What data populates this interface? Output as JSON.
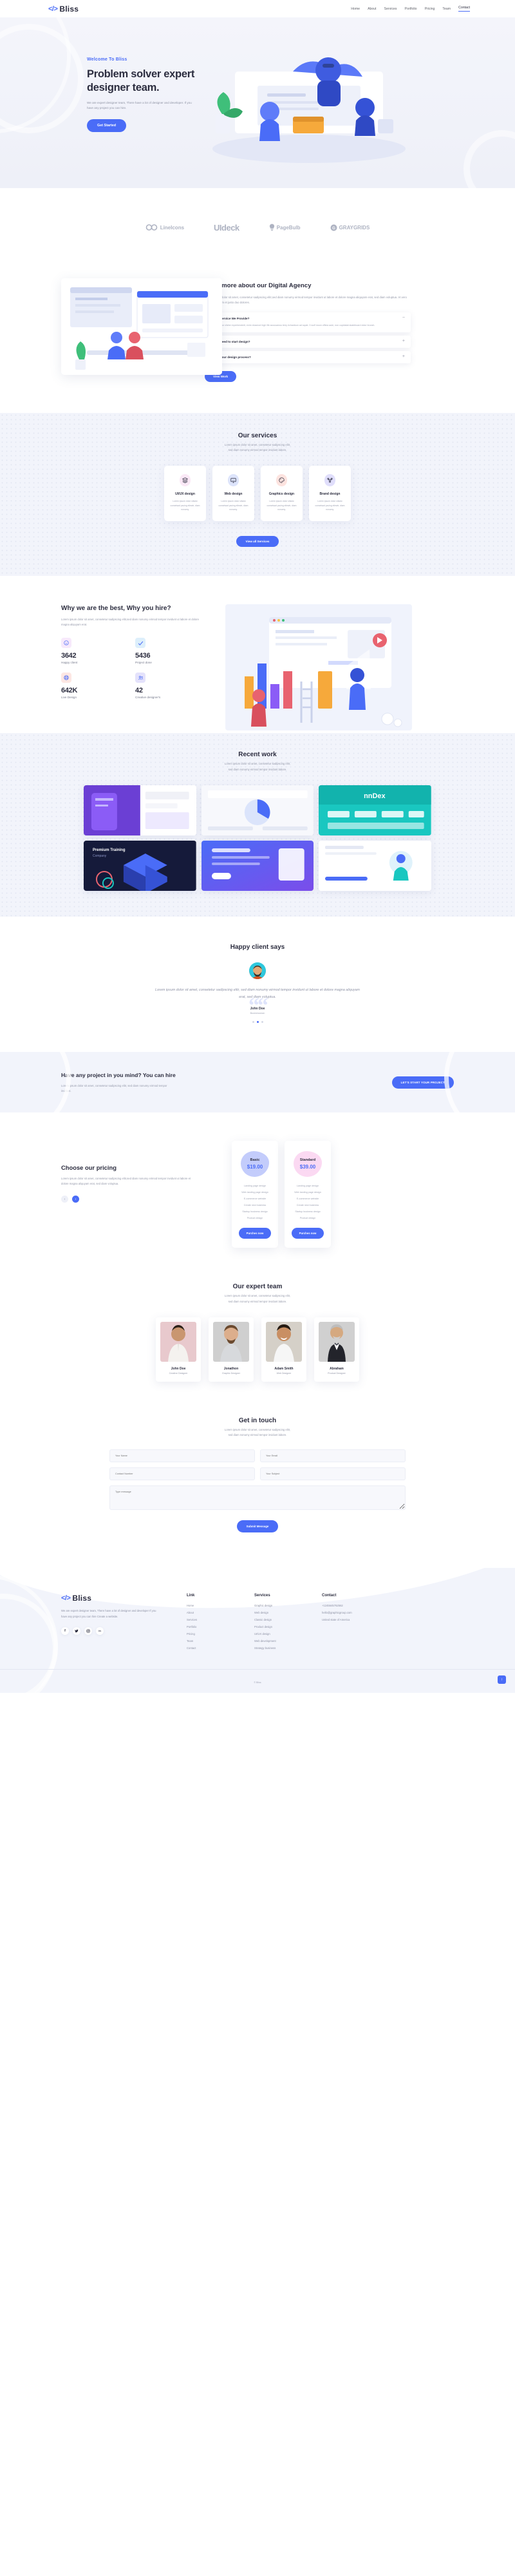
{
  "brand": {
    "mark": "</>",
    "name": "Bliss"
  },
  "colors": {
    "accent": "#4a6cf7",
    "dark": "#2c2d3f",
    "muted": "#9599aa",
    "light_bg": "#f2f4fb"
  },
  "nav": {
    "items": [
      "Home",
      "About",
      "Services",
      "Portfolio",
      "Pricing",
      "Team",
      "Contact"
    ],
    "active": "Contact"
  },
  "hero": {
    "kicker": "Welcome To Bliss",
    "title": "Problem solver expert designer team.",
    "desc": "We are expert designer team, There have a lot of designer and developer. If you have any project you can hire.",
    "button": "Get Started"
  },
  "brands": [
    {
      "name": "LineIcons",
      "icon": "infinity-icon"
    },
    {
      "name": "UIdeck",
      "icon": "uideck-icon"
    },
    {
      "name": "PageBulb",
      "icon": "bulb-icon"
    },
    {
      "name": "GRAYGRIDS",
      "icon": "circle-g-icon"
    }
  ],
  "about": {
    "title": "Read more about our Digital Agency",
    "desc": "Lorem ipsum dolor sit amet, consetetur sadipscing elitr,sed diam nonumy eirmod tempor invidunt ut labore et dolore magna aliquyam erat, sed diam voluptua. At vero eos et accusam et justo duo dolores.",
    "faq": [
      {
        "q": "Which Service We Provide?",
        "sign": "−",
        "a": "Anim pariatur cliche reprehenderit, enim eiusmod high life accusamus terry richardson ad squid. 3 wolf moon officia aute, non cupidatat skateboard dolor brunch.",
        "open": true
      },
      {
        "q": "What I need to start design?",
        "sign": "+",
        "a": "",
        "open": false
      },
      {
        "q": "What is our design process?",
        "sign": "+",
        "a": "",
        "open": false
      }
    ],
    "button": "View Work"
  },
  "services": {
    "title": "Our services",
    "subtitle": "Lorem ipsum dolor sit amet, consetetur sadipscing elitr,\nsed diam nonumy eirmod tempor invidunt labore.",
    "cards": [
      {
        "name": "UI/UX design",
        "text": "Lorem ipsum dolor sitsdw consetsad pscing eliewtr, diam nonumy.",
        "icon": "layers-icon",
        "bg": "#fbe8f6"
      },
      {
        "name": "Web design",
        "text": "Lorem ipsum dolor sitsdw consetsad pscing eliewtr, diam nonumy.",
        "icon": "code-monitor-icon",
        "bg": "#dde4fb"
      },
      {
        "name": "Graphics design",
        "text": "Lorem ipsum dolor sitsdw consetsad pscing eliewtr, diam nonumy.",
        "icon": "palette-icon",
        "bg": "#fde3df"
      },
      {
        "name": "Brand design",
        "text": "Lorem ipsum dolor sitsdw consetsad pscing eliewtr, diam nonumy.",
        "icon": "network-icon",
        "bg": "#e0defb"
      }
    ],
    "button": "View all Services"
  },
  "why": {
    "title": "Why we are the best, Why you hire?",
    "desc": "Lorem ipsum dolor sit amet, consetetur sadipscing elitr,sed diam nonumy eirmod tempor invidunt ut labore et dolore magna aliquyam erat.",
    "stats": [
      {
        "value": "3642",
        "label": "Happy client",
        "icon": "smiley-icon",
        "bg": "#f7e9fb"
      },
      {
        "value": "5436",
        "label": "Project done",
        "icon": "check-icon",
        "bg": "#ddeffb"
      },
      {
        "value": "642K",
        "label": "Live Design",
        "icon": "globe-icon",
        "bg": "#fde7e3"
      },
      {
        "value": "42",
        "label": "Creative designer's",
        "icon": "users-icon",
        "bg": "#e4e2fb"
      }
    ]
  },
  "portfolio": {
    "title": "Recent work",
    "subtitle": "Lorem ipsum dolor sit amet, consetetur sadipscing elitr,\nsed diam nonumy eirmod tempor invidunt labore.",
    "items": [
      {
        "name": "mobile-app-purple"
      },
      {
        "name": "dashboard-light"
      },
      {
        "name": "branding-teal"
      },
      {
        "name": "isometric-dark"
      },
      {
        "name": "blue-gradient-ui"
      },
      {
        "name": "illustration-white"
      }
    ]
  },
  "testimonial": {
    "title": "Happy client says",
    "quote": "Lorem ipsum dolor sit amet, consetetur sadipscing elitr, sed diam nonumy eirmod tempor invidunt ut labore et dolore magna aliquyam erat, sed diam voluptua.",
    "name": "John Doe",
    "role": "Businessman",
    "dots": 3,
    "active_dot": 1
  },
  "cta": {
    "title": "Have any project in you mind? You can hire",
    "desc": "Lorem ipsum dolor sit amet, consetetur sadipscing elitr, sed diam nonumy eirmod tempor invidunt.",
    "button": "LET'S START YOUR PROJECT"
  },
  "pricing": {
    "title": "Choose our pricing",
    "desc": "Lorem ipsum dolor sit amet, consetetur sadipscing elitr,sed diam nonumy eirmod tempor invidunt ut labore et dolore magna aliquyam erat, sed diam voluptua.",
    "prev": "‹",
    "next": "›",
    "plans": [
      {
        "name": "Basic",
        "price": "$19.00",
        "blob": "#c3ccfb",
        "features": [
          "Landing page design",
          "Web landing page design",
          "E-commerce website",
          "Create new business",
          "Startup business design",
          "Product design"
        ],
        "button": "Purches now"
      },
      {
        "name": "Standard",
        "price": "$39.00",
        "blob": "#fbd9f2",
        "features": [
          "Landing page design",
          "Web landing page design",
          "E-commerce website",
          "Create new business",
          "Startup business design",
          "Product design"
        ],
        "button": "Purches now"
      }
    ]
  },
  "team": {
    "title": "Our expert team",
    "subtitle": "Lorem ipsum dolor sit amet, consetetur sadipscing elitr,\nsed diam nonumy eirmod tempor invidunt labore.",
    "members": [
      {
        "name": "John Doe",
        "role": "Creative Designer",
        "bg": "#e8c9cd",
        "shirt": "#f4f2ef",
        "skin": "#c99670"
      },
      {
        "name": "Jonathon",
        "role": "Graphic Designer",
        "bg": "#cfcfcf",
        "shirt": "#d7d9dc",
        "skin": "#dcae8c"
      },
      {
        "name": "Adam Smith",
        "role": "Web Designer",
        "bg": "#d5d0c8",
        "shirt": "#f6f6f6",
        "skin": "#c98f63"
      },
      {
        "name": "Abraham",
        "role": "Product Designer",
        "bg": "#d0d0d0",
        "shirt": "#23242b",
        "skin": "#d5a980"
      }
    ]
  },
  "contact": {
    "title": "Get in touch",
    "subtitle": "Lorem ipsum dolor sit amet, consetetur sadipscing elitr,\nsed diam nonumy eirmod tempor invidunt labore.",
    "fields": {
      "name_placeholder": "Your Name",
      "email_placeholder": "Your Email",
      "phone_placeholder": "Contact Number",
      "subject_placeholder": "Your Subject",
      "message_placeholder": "Type message"
    },
    "button": "Submit Message"
  },
  "footer": {
    "desc": "We are expert designer team, There have a lot of designer and developer If you have any project you can hire Create a website.",
    "social": [
      {
        "name": "facebook-icon",
        "glyph": "f"
      },
      {
        "name": "twitter-icon",
        "glyph": "ᴛ"
      },
      {
        "name": "instagram-icon",
        "glyph": "□"
      },
      {
        "name": "linkedin-icon",
        "glyph": "in"
      }
    ],
    "columns": [
      {
        "head": "Link",
        "items": [
          "Home",
          "About",
          "Services",
          "Portfolio",
          "Pricing",
          "Team",
          "Contact"
        ]
      },
      {
        "head": "Services",
        "items": [
          "Graphic design",
          "Web design",
          "Classic design",
          "Product design",
          "UI/UX design",
          "Web development",
          "Strategy business"
        ]
      },
      {
        "head": "Contact",
        "items": [
          "+1245645762562",
          "hello@graphicgroup.com",
          "United state of America"
        ]
      }
    ],
    "copyright": "© Bliss",
    "scroll_top": "↑"
  }
}
